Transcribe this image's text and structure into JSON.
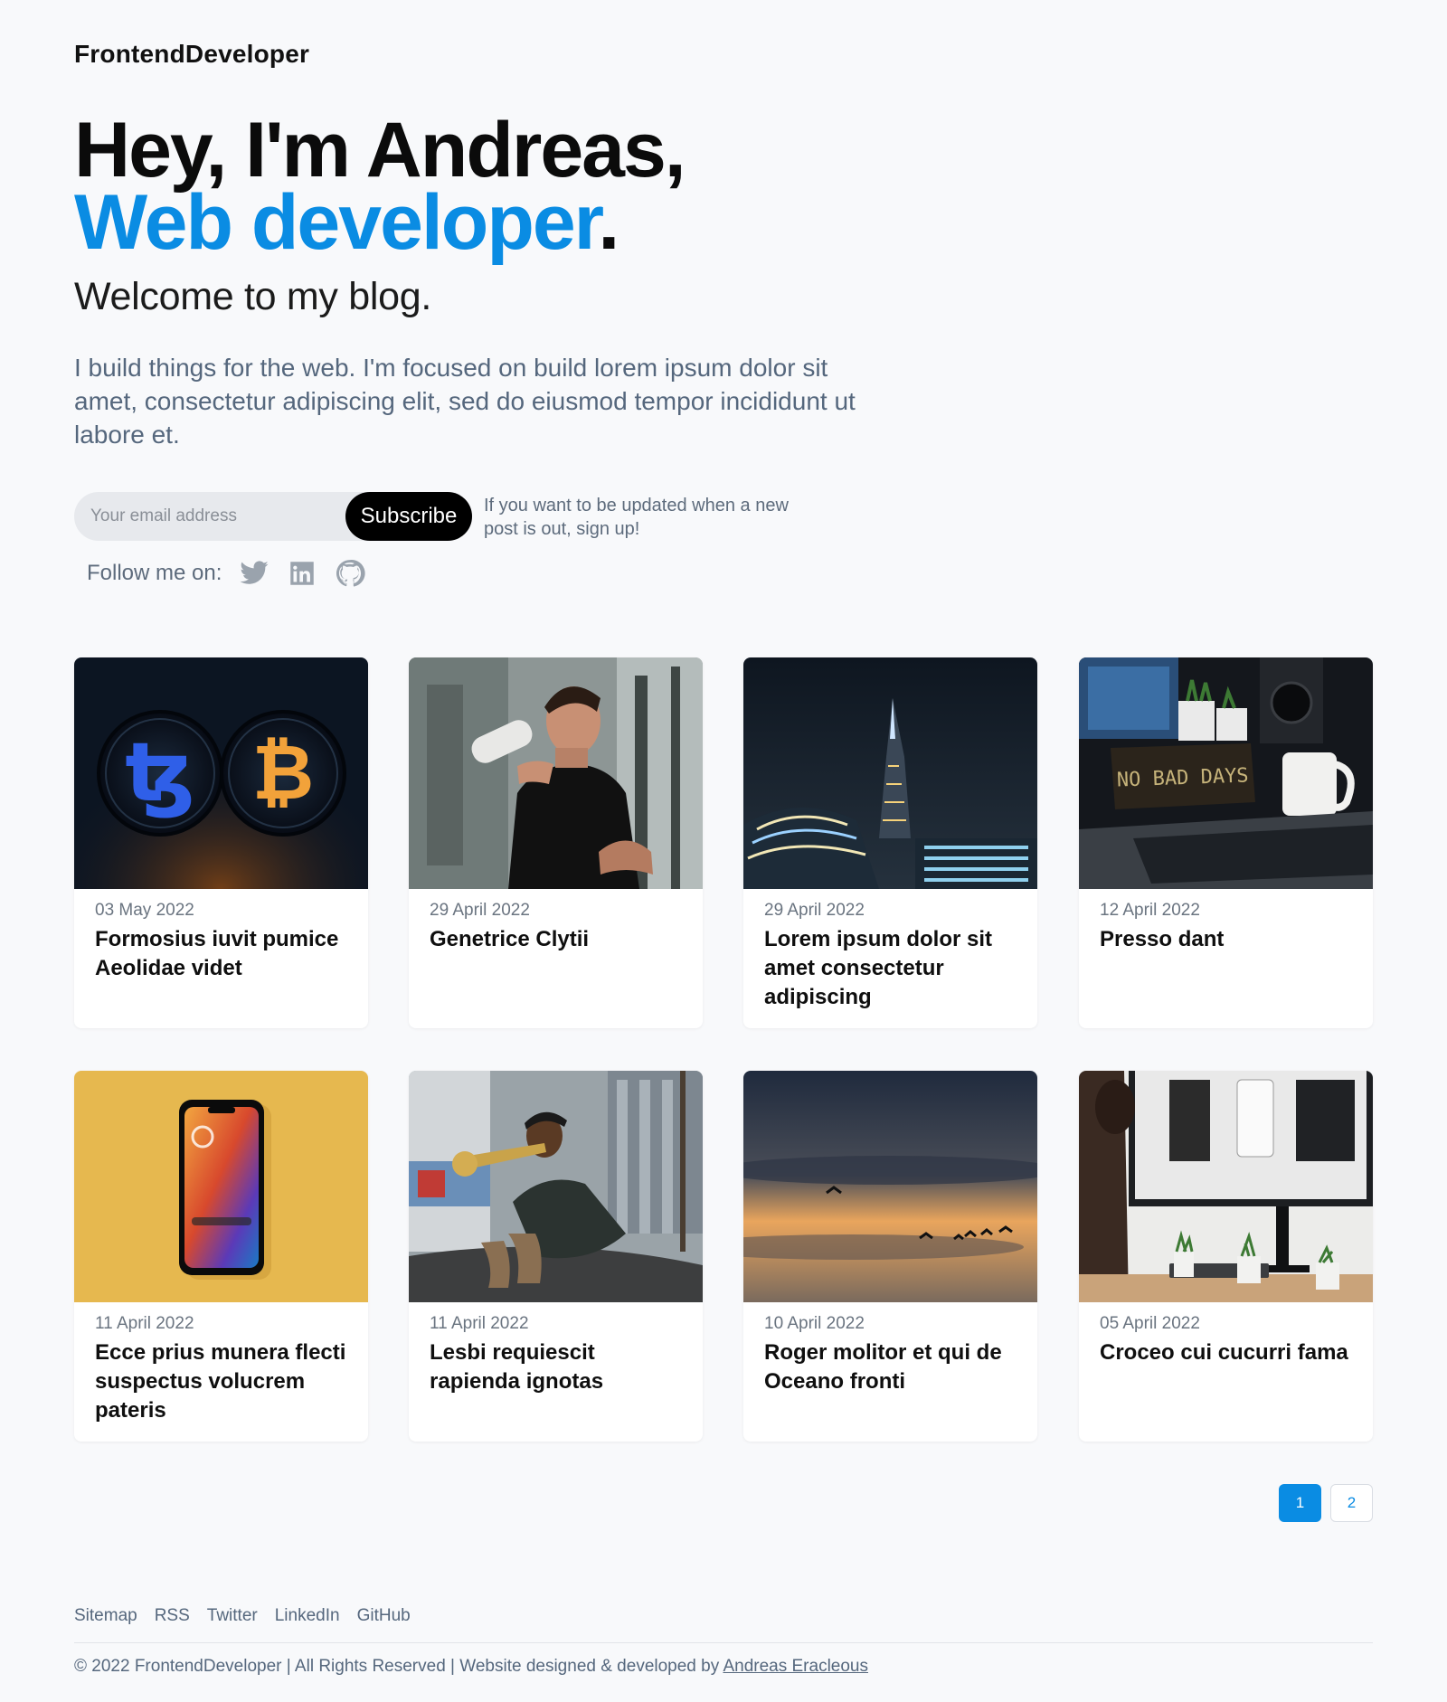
{
  "header": {
    "brand": "FrontendDeveloper"
  },
  "hero": {
    "line1": "Hey, I'm Andreas,",
    "line2_accent": "Web developer",
    "line2_dot": ".",
    "welcome": "Welcome to my blog.",
    "intro": "I build things for the web. I'm focused on build lorem ipsum dolor sit amet, consectetur adipiscing elit, sed do eiusmod tempor incididunt ut labore et."
  },
  "subscribe": {
    "placeholder": "Your email address",
    "button": "Subscribe",
    "note": "If you want to be updated when a new post is out, sign up!"
  },
  "follow": {
    "label": "Follow me on:",
    "icons": [
      "twitter-icon",
      "linkedin-icon",
      "github-icon"
    ]
  },
  "posts": [
    {
      "date": "03 May 2022",
      "title": "Formosius iuvit pumice Aeolidae videt",
      "image": "crypto-coins"
    },
    {
      "date": "29 April 2022",
      "title": "Genetrice Clytii",
      "image": "man-drinking"
    },
    {
      "date": "29 April 2022",
      "title": "Lorem ipsum dolor sit amet consectetur adipiscing",
      "image": "city-night"
    },
    {
      "date": "12 April 2022",
      "title": "Presso dant",
      "image": "desk-mug"
    },
    {
      "date": "11 April 2022",
      "title": "Ecce prius munera flecti suspectus volucrem pateris",
      "image": "phone-yellow"
    },
    {
      "date": "11 April 2022",
      "title": "Lesbi requiescit rapienda ignotas",
      "image": "trumpet-player"
    },
    {
      "date": "10 April 2022",
      "title": "Roger molitor et qui de Oceano fronti",
      "image": "sunset-birds"
    },
    {
      "date": "05 April 2022",
      "title": "Croceo cui cucurri fama",
      "image": "monitor-plants"
    }
  ],
  "pagination": {
    "pages": [
      "1",
      "2"
    ],
    "current": "1"
  },
  "footer": {
    "links": [
      "Sitemap",
      "RSS",
      "Twitter",
      "LinkedIn",
      "GitHub"
    ],
    "copyright_prefix": "© 2022 FrontendDeveloper | All Rights Reserved | Website designed & developed by ",
    "copyright_link": "Andreas Eracleous"
  },
  "colors": {
    "accent": "#0a8ce3",
    "background": "#f8f9fb",
    "muted_text": "#55677d"
  }
}
